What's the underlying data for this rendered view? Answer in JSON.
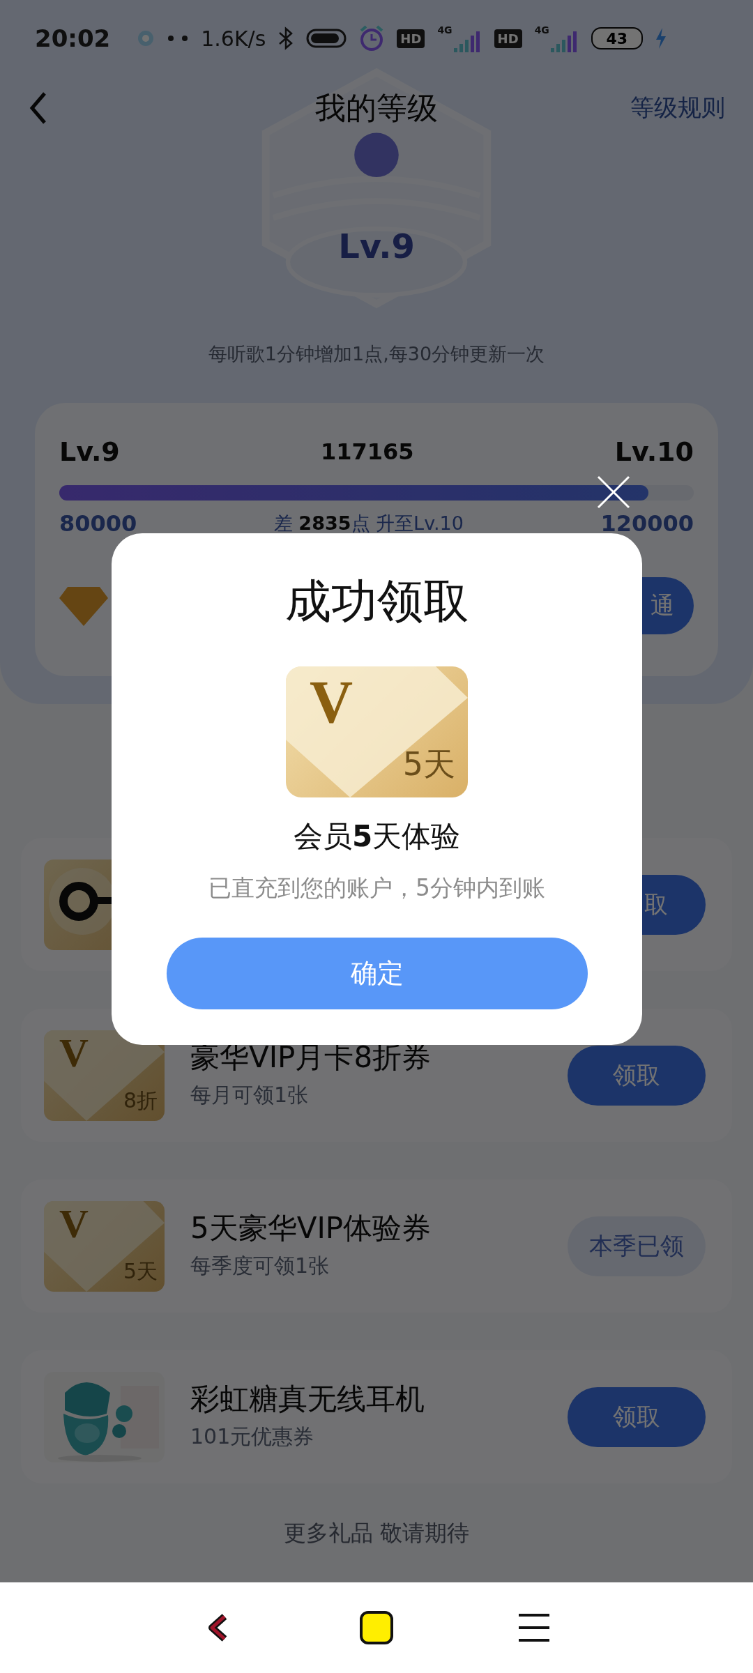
{
  "status_bar": {
    "time": "20:02",
    "speed": "1.6K/s",
    "sims": [
      {
        "hd": "HD",
        "net": "4G"
      },
      {
        "hd": "HD",
        "net": "4G"
      }
    ],
    "battery": "43"
  },
  "header": {
    "title": "我的等级",
    "rules_link": "等级规则"
  },
  "badge": {
    "level": "Lv.9"
  },
  "hint": "每听歌1分钟增加1点,每30分钟更新一次",
  "level_card": {
    "current": "Lv.9",
    "points": "117165",
    "next": "Lv.10",
    "progress": {
      "level": 0.929
    },
    "min": "80000",
    "gap": "差 **2835**点 升至Lv.10",
    "max": "120000",
    "vip_button": "通"
  },
  "gifts": [
    {
      "kind": "logo",
      "button": "取",
      "disabled": false
    },
    {
      "kind": "v-card",
      "mark": "V",
      "tag": "8折",
      "title": "豪华VIP月卡8折券",
      "subtitle": "每月可领1张",
      "button": "领取",
      "disabled": false
    },
    {
      "kind": "v-card",
      "mark": "V",
      "tag": "5天",
      "title": "5天豪华VIP体验券",
      "subtitle": "每季度可领1张",
      "button": "本季已领",
      "disabled": true
    },
    {
      "kind": "picture",
      "title": "彩虹糖真无线耳机",
      "subtitle": "101元优惠券",
      "button": "领取",
      "disabled": false
    }
  ],
  "footer": "更多礼品 敬请期待",
  "dialog": {
    "title": "成功领取",
    "card_mark": "V",
    "card_tag": "5天",
    "name": "会员**5**天体验",
    "message": "已直充到您的账户，5分钟内到账",
    "confirm": "确定"
  }
}
